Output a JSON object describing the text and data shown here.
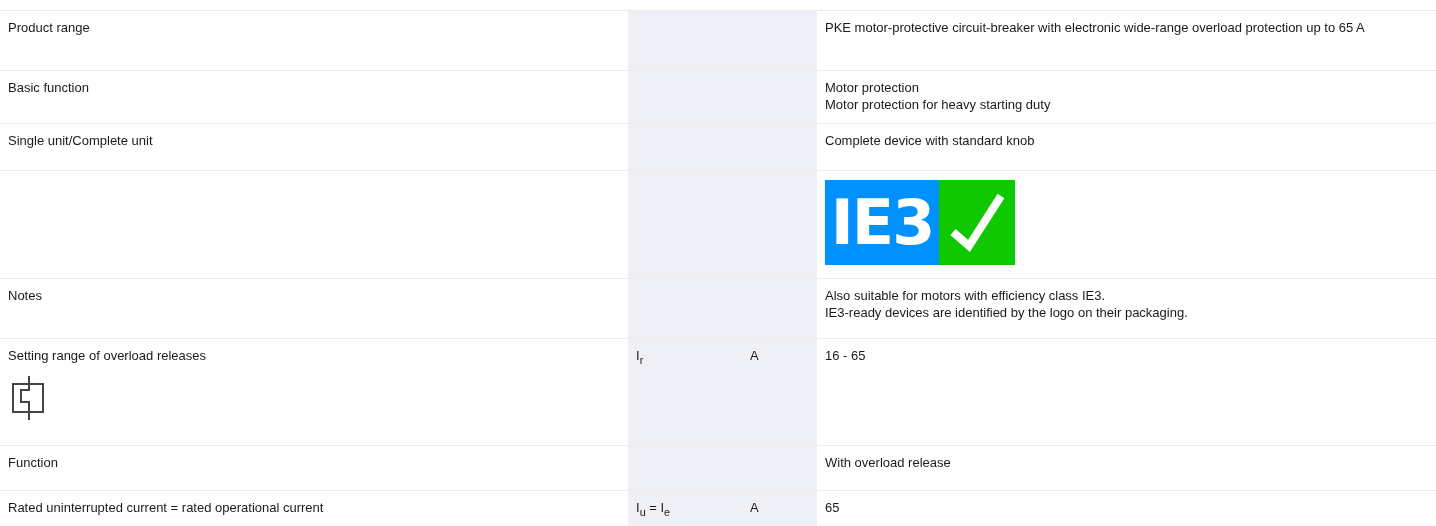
{
  "table": {
    "rows": [
      {
        "kind": "text",
        "label": "Product range",
        "symbol": "",
        "unit": "",
        "value": [
          "PKE motor-protective circuit-breaker with electronic wide-range overload protection up to 65 A"
        ]
      },
      {
        "kind": "text",
        "label": "Basic function",
        "symbol": "",
        "unit": "",
        "value": [
          "Motor protection",
          "Motor protection for heavy starting duty"
        ]
      },
      {
        "kind": "text",
        "label": "Single unit/Complete unit",
        "symbol": "",
        "unit": "",
        "value": [
          "Complete device with standard knob"
        ]
      },
      {
        "kind": "logo",
        "label": "",
        "symbol": "",
        "unit": "",
        "logo_text": "IE3",
        "value": []
      },
      {
        "kind": "text",
        "label": "Notes",
        "symbol": "",
        "unit": "",
        "value": [
          "Also suitable for motors with efficiency class IE3.",
          "IE3-ready devices are identified by the logo on their packaging."
        ]
      },
      {
        "kind": "diagram",
        "label": "Setting range of overload releases",
        "symbol": "I$_{r}$",
        "unit": "A",
        "value": [
          "16 - 65"
        ]
      },
      {
        "kind": "text",
        "label": "Function",
        "symbol": "",
        "unit": "",
        "value": [
          "With overload release"
        ]
      },
      {
        "kind": "text",
        "label": "Rated uninterrupted current = rated operational current",
        "symbol": "I$_{u}$ = I$_{e}$",
        "unit": "A",
        "value": [
          "65"
        ]
      }
    ]
  }
}
